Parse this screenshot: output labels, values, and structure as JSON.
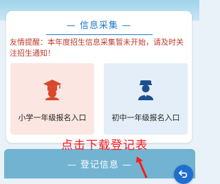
{
  "card": {
    "title": "—   信息采集   —",
    "notice": "友情提醒：本年度招生信息采集暂未开始，请及时关注招生通知！"
  },
  "entries": [
    {
      "label": "小学一年级报名入口",
      "icon": "graduation-cap-icon"
    },
    {
      "label": "初中一年级报名入口",
      "icon": "student-icon"
    }
  ],
  "overlay": {
    "text": "点击下载登记表"
  },
  "register_bar": {
    "label": "—   登记信息   —"
  },
  "fab": {
    "icon": "back-icon"
  },
  "colors": {
    "accent": "#1e78c8",
    "notice": "#c0392b",
    "primary_card": "#fbe6e2",
    "junior_card": "#e4eef8",
    "overlay_text": "#ff1a1a",
    "register_bar": "#72b3d1"
  }
}
